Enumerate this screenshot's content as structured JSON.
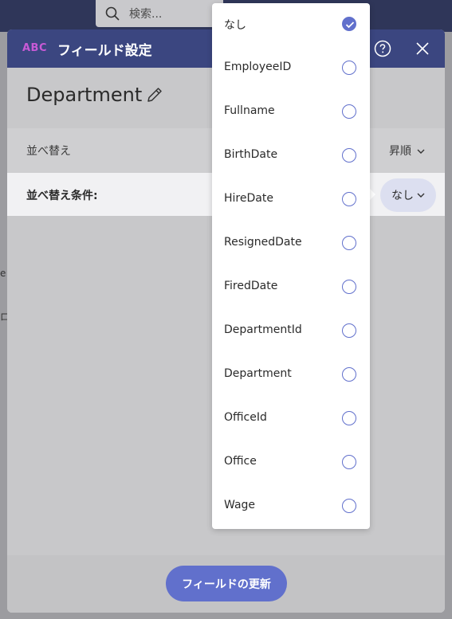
{
  "background": {
    "search_placeholder": "検索...",
    "left_fragments": [
      "e",
      "ロ"
    ]
  },
  "dialog": {
    "title": "フィールド設定",
    "type_icon_label": "ABC",
    "field_name": "Department",
    "sort_label": "並べ替え",
    "sort_order": "昇順",
    "sort_by_label": "並べ替え条件:",
    "sort_by_value": "なし",
    "update_button": "フィールドの更新"
  },
  "dropdown": {
    "items": [
      {
        "label": "なし",
        "checked": true
      },
      {
        "label": "EmployeeID",
        "checked": false
      },
      {
        "label": "Fullname",
        "checked": false
      },
      {
        "label": "BirthDate",
        "checked": false
      },
      {
        "label": "HireDate",
        "checked": false
      },
      {
        "label": "ResignedDate",
        "checked": false
      },
      {
        "label": "FiredDate",
        "checked": false
      },
      {
        "label": "DepartmentId",
        "checked": false
      },
      {
        "label": "Department",
        "checked": false
      },
      {
        "label": "OfficeId",
        "checked": false
      },
      {
        "label": "Office",
        "checked": false
      },
      {
        "label": "Wage",
        "checked": false
      }
    ]
  },
  "colors": {
    "header": "#3b4680",
    "accent": "#6170cc",
    "abc_icon": "#c85ad6"
  }
}
